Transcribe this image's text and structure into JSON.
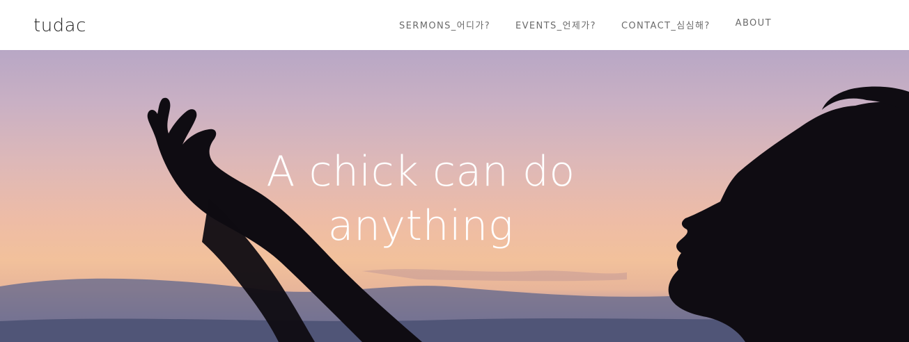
{
  "site": {
    "logo": "tudac"
  },
  "nav": {
    "items": [
      {
        "label": "SERMONS_어디가?"
      },
      {
        "label": "EVENTS_언제가?"
      },
      {
        "label": "CONTACT_심심해?"
      },
      {
        "label": "ABOUT"
      }
    ]
  },
  "hero": {
    "title": "A chick can do anything",
    "image": "sunset-sky-silhouette-woman-raising-hand",
    "colors": {
      "sky_top": "#b8a7c5",
      "sky_mid": "#ddb8b8",
      "sky_glow": "#f2c19b",
      "clouds": "#6f6f8e",
      "silhouette": "#0f0c12"
    }
  }
}
